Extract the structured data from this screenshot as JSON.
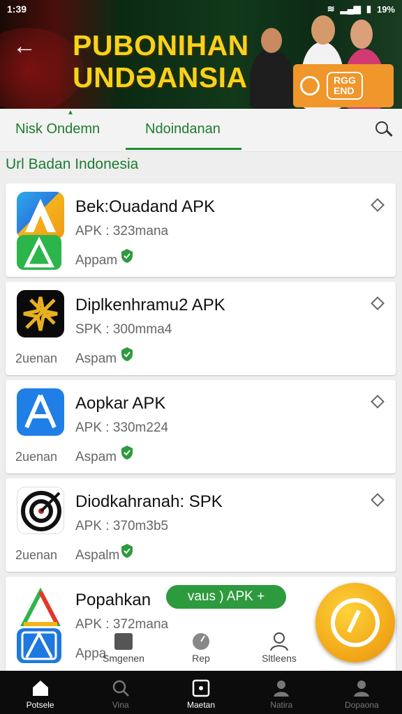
{
  "status": {
    "time": "1:39",
    "battery": "19%"
  },
  "banner": {
    "line1": "PUBONIHAN",
    "line2": "UNDƏANSIA",
    "promo_text_1": "RGG",
    "promo_text_2": "END"
  },
  "tabs": [
    {
      "label": "Nisk Ondemn"
    },
    {
      "label": "Ndoindanan"
    }
  ],
  "section_title": "Url Badan Indonesia",
  "cards": [
    {
      "title": "Bek:Ouadand APK",
      "sub": "APK : 323mana",
      "meta": "Appam",
      "left": ""
    },
    {
      "title": "Diplkenhramu2 APK",
      "sub": "SPK : 300mma4",
      "meta": "Aspam",
      "left": "2uenan"
    },
    {
      "title": "Aopkar APK",
      "sub": "APK : 330m224",
      "meta": "Aspam",
      "left": "2uenan"
    },
    {
      "title": "Diodkahranah: SPK",
      "sub": "APK : 370m3b5",
      "meta": "Aspalm",
      "left": "2uenan"
    },
    {
      "title": "Popahkan",
      "sub": "APK : 372mana",
      "meta": "Appa",
      "badge": "vaus ) APK +"
    }
  ],
  "mini_nav": [
    {
      "label": "Smgenen"
    },
    {
      "label": "Rep"
    },
    {
      "label": "Sltleens"
    }
  ],
  "bottom_nav": [
    {
      "label": "Potsele",
      "active": true
    },
    {
      "label": "Vina",
      "active": false
    },
    {
      "label": "Maetan",
      "active": true
    },
    {
      "label": "Natira",
      "active": false
    },
    {
      "label": "Dopaona",
      "active": false
    }
  ],
  "colors": {
    "accent": "#1f8a36",
    "banner_text": "#f7d21b",
    "fab": "#f0a416"
  }
}
